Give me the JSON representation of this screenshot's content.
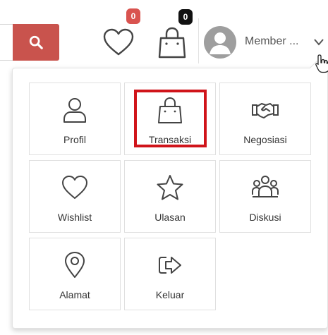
{
  "header": {
    "wishlist_count": "0",
    "cart_count": "0",
    "member_name": "Member ...",
    "icons": {
      "search": "search-icon",
      "wishlist": "heart-icon",
      "cart": "shopping-bag-icon",
      "avatar": "user-avatar-icon",
      "chevron": "chevron-down-icon",
      "cursor": "hand-cursor-icon"
    }
  },
  "menu": {
    "items": [
      {
        "label": "Profil",
        "icon": "user-icon"
      },
      {
        "label": "Transaksi",
        "icon": "shopping-bag-icon"
      },
      {
        "label": "Negosiasi",
        "icon": "handshake-icon"
      },
      {
        "label": "Wishlist",
        "icon": "heart-icon"
      },
      {
        "label": "Ulasan",
        "icon": "star-icon"
      },
      {
        "label": "Diskusi",
        "icon": "group-icon"
      },
      {
        "label": "Alamat",
        "icon": "location-pin-icon"
      },
      {
        "label": "Keluar",
        "icon": "logout-icon"
      }
    ],
    "highlighted_item": "Transaksi"
  },
  "colors": {
    "search_button": "#c9534d",
    "wishlist_badge": "#d9534f",
    "cart_badge": "#111111",
    "highlight_border": "#d0141a"
  }
}
